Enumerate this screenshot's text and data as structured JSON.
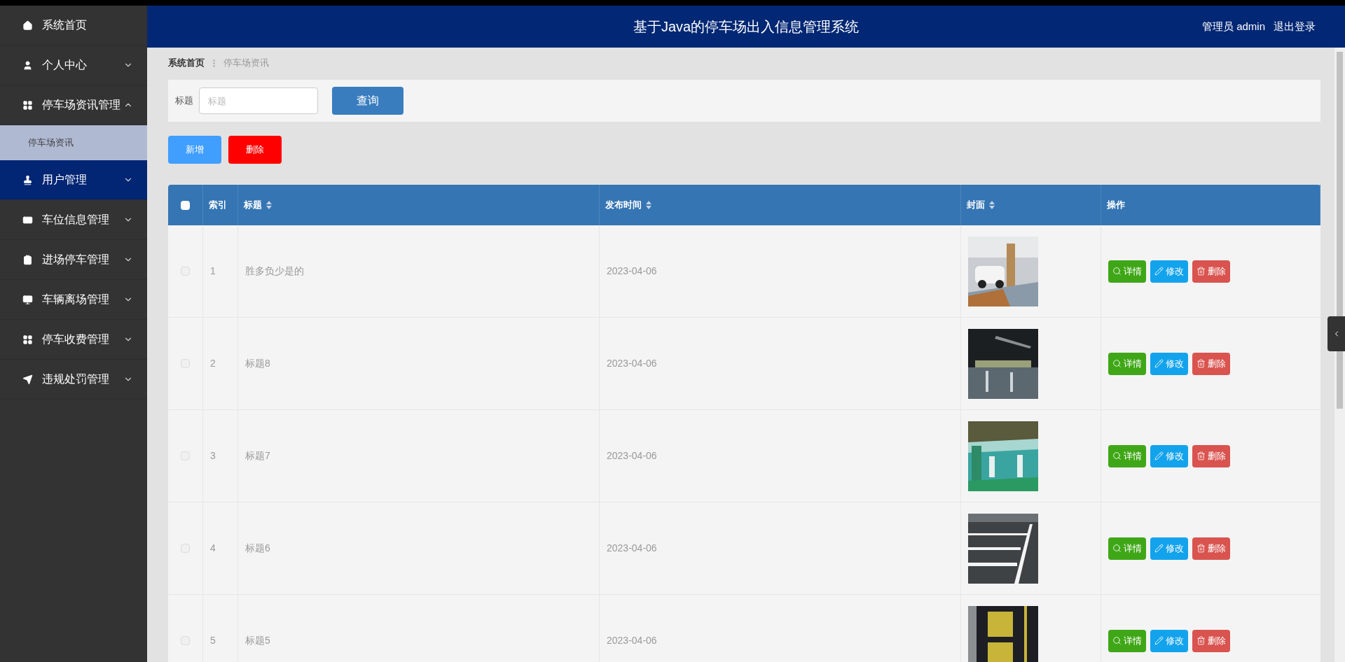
{
  "header": {
    "title": "基于Java的停车场出入信息管理系统",
    "user": "管理员 admin",
    "logout": "退出登录"
  },
  "sidebar": {
    "items": [
      {
        "label": "系统首页",
        "kind": "link",
        "highlighted": false
      },
      {
        "label": "个人中心",
        "kind": "menu",
        "expanded": false,
        "highlighted": false
      },
      {
        "label": "停车场资讯管理",
        "kind": "menu",
        "expanded": true,
        "highlighted": false,
        "children": [
          {
            "label": "停车场资讯",
            "selected": true
          }
        ]
      },
      {
        "label": "用户管理",
        "kind": "menu",
        "expanded": false,
        "highlighted": true
      },
      {
        "label": "车位信息管理",
        "kind": "menu",
        "expanded": false,
        "highlighted": false
      },
      {
        "label": "进场停车管理",
        "kind": "menu",
        "expanded": false,
        "highlighted": false
      },
      {
        "label": "车辆离场管理",
        "kind": "menu",
        "expanded": false,
        "highlighted": false
      },
      {
        "label": "停车收费管理",
        "kind": "menu",
        "expanded": false,
        "highlighted": false
      },
      {
        "label": "违规处罚管理",
        "kind": "menu",
        "expanded": false,
        "highlighted": false
      }
    ]
  },
  "breadcrumb": [
    "系统首页",
    "停车场资讯"
  ],
  "search": {
    "label": "标题",
    "placeholder": "标题",
    "button": "查询"
  },
  "actions": {
    "add": "新增",
    "delete": "删除"
  },
  "table": {
    "select_all_checked": false,
    "columns": [
      {
        "label": "索引",
        "sortable": false
      },
      {
        "label": "标题",
        "sortable": true
      },
      {
        "label": "发布时间",
        "sortable": true
      },
      {
        "label": "封面",
        "sortable": true
      },
      {
        "label": "操作",
        "sortable": false
      }
    ],
    "rows": [
      {
        "checked": false,
        "index": "1",
        "title": "胜多负少是的",
        "date": "2023-04-06",
        "buttons": [
          "详情",
          "修改",
          "删除"
        ]
      },
      {
        "checked": false,
        "index": "2",
        "title": "标题8",
        "date": "2023-04-06",
        "buttons": [
          "详情",
          "修改",
          "删除"
        ]
      },
      {
        "checked": false,
        "index": "3",
        "title": "标题7",
        "date": "2023-04-06",
        "buttons": [
          "详情",
          "修改",
          "删除"
        ]
      },
      {
        "checked": false,
        "index": "4",
        "title": "标题6",
        "date": "2023-04-06",
        "buttons": [
          "详情",
          "修改",
          "删除"
        ]
      },
      {
        "checked": false,
        "index": "5",
        "title": "标题5",
        "date": "2023-04-06",
        "buttons": [
          "详情",
          "修改",
          "删除"
        ]
      }
    ]
  }
}
